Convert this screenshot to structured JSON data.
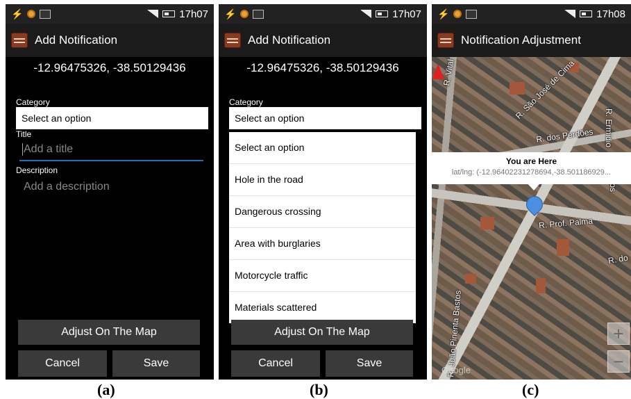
{
  "status_bar": {
    "time_a": "17h07",
    "time_b": "17h07",
    "time_c": "17h08"
  },
  "panel_a": {
    "title": "Add Notification",
    "coords": "-12.96475326, -38.50129436",
    "category_label": "Category",
    "category_value": "Select an option",
    "title_label": "Title",
    "title_placeholder": "Add a title",
    "description_label": "Description",
    "description_placeholder": "Add a description",
    "adjust_button": "Adjust On The Map",
    "cancel_button": "Cancel",
    "save_button": "Save",
    "caption": "(a)"
  },
  "panel_b": {
    "title": "Add Notification",
    "coords": "-12.96475326, -38.50129436",
    "category_label": "Category",
    "category_value": "Select an option",
    "options": [
      "Select an option",
      "Hole in the road",
      "Dangerous crossing",
      "Area with burglaries",
      "Motorcycle traffic",
      "Materials scattered"
    ],
    "adjust_button": "Adjust On The Map",
    "cancel_button": "Cancel",
    "save_button": "Save",
    "caption": "(b)"
  },
  "panel_c": {
    "title": "Notification Adjustment",
    "popup_title": "You are Here",
    "popup_sub": "lat/lng: (-12.96402231278694,-38.501186929...",
    "streets": {
      "vital": "R. Vital",
      "sao_jose": "R. São José de Cima",
      "perdoes": "R. dos Perdões",
      "ermidio": "R. Ermidio",
      "prof_palma": "R. Prof. Palma",
      "pinenta": "R. João Pinenta Bastos",
      "do": "R. do",
      "tos": "tos"
    },
    "zoom_in": "+",
    "zoom_out": "−",
    "google": "Google",
    "caption": "(c)"
  }
}
